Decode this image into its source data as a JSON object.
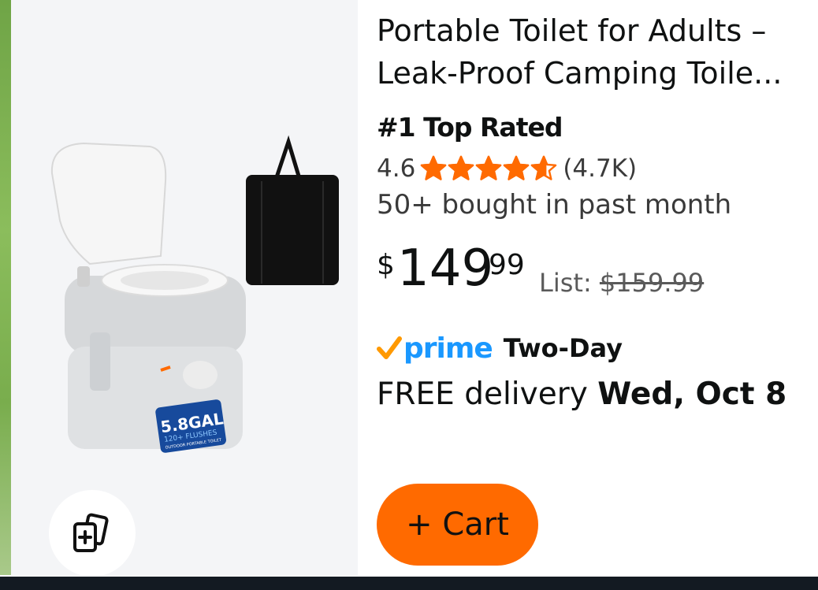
{
  "product": {
    "title_line1": "Portable Toilet for Adults –",
    "title_line2": "Leak-Proof Camping Toile...",
    "badge": "#1 Top Rated",
    "rating_value": "4.6",
    "rating_fraction": 0.92,
    "review_count": "(4.7K)",
    "bought_text": "50+ bought in past month",
    "price": {
      "symbol": "$",
      "whole": "149",
      "fraction": "99",
      "list_label": "List:",
      "list_price": "$159.99"
    },
    "prime": {
      "word": "prime",
      "speed": "Two-Day"
    },
    "delivery": {
      "prefix": "FREE delivery",
      "date": "Wed, Oct 8"
    },
    "image": {
      "capacity": "5.8GAL",
      "flushes": "120+ FLUSHES",
      "caption": "OUTDOOR PORTABLE TOILET"
    }
  },
  "actions": {
    "cart_label": "+ Cart",
    "compare_icon": "compare-cards-icon"
  },
  "colors": {
    "star": "#ff6a00",
    "prime_blue": "#1a98ff",
    "prime_check": "#ff9900",
    "cart_button": "#ff6a00",
    "bottom_bar": "#131a22"
  }
}
